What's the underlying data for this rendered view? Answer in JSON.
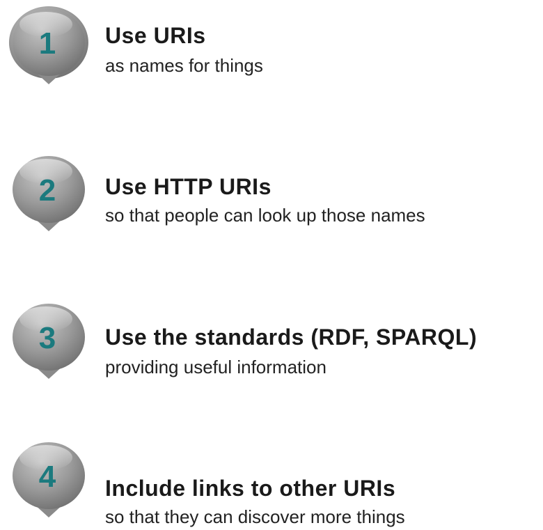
{
  "colors": {
    "bubble": "#9a9a9a",
    "number": "#1b7a7e"
  },
  "steps": [
    {
      "number": "1",
      "title": "Use URIs",
      "subtitle": "as names for things"
    },
    {
      "number": "2",
      "title": "Use HTTP URIs",
      "subtitle": "so that people can look up those names"
    },
    {
      "number": "3",
      "title": "Use the standards (RDF, SPARQL)",
      "subtitle": "providing useful information"
    },
    {
      "number": "4",
      "title": "Include links to other URIs",
      "subtitle": "so that they can discover more things"
    }
  ]
}
